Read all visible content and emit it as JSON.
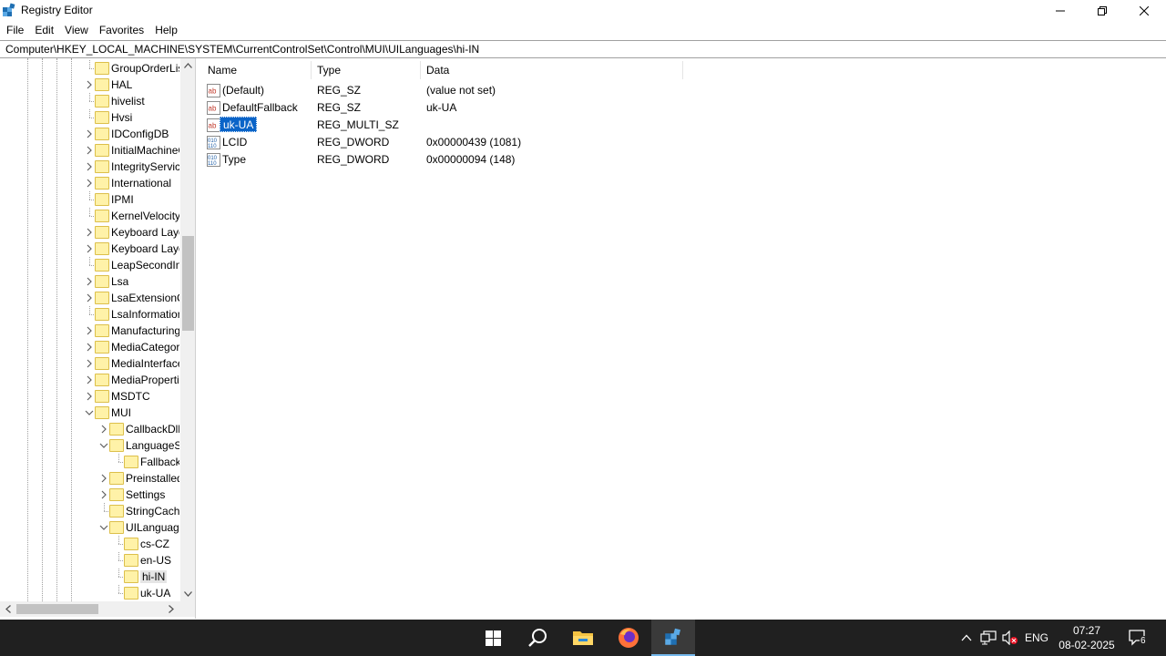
{
  "window": {
    "title": "Registry Editor",
    "min_icon": "minimize-icon",
    "max_icon": "restore-icon",
    "close_icon": "close-icon"
  },
  "menu": [
    "File",
    "Edit",
    "View",
    "Favorites",
    "Help"
  ],
  "address": "Computer\\HKEY_LOCAL_MACHINE\\SYSTEM\\CurrentControlSet\\Control\\MUI\\UILanguages\\hi-IN",
  "tree": {
    "items": [
      {
        "label": "GroupOrderList",
        "expand": "none",
        "level": 0
      },
      {
        "label": "HAL",
        "expand": "collapsed",
        "level": 0
      },
      {
        "label": "hivelist",
        "expand": "none",
        "level": 0
      },
      {
        "label": "Hvsi",
        "expand": "none",
        "level": 0
      },
      {
        "label": "IDConfigDB",
        "expand": "collapsed",
        "level": 0
      },
      {
        "label": "InitialMachineConfig",
        "expand": "collapsed",
        "level": 0
      },
      {
        "label": "IntegrityServices",
        "expand": "collapsed",
        "level": 0
      },
      {
        "label": "International",
        "expand": "collapsed",
        "level": 0
      },
      {
        "label": "IPMI",
        "expand": "none",
        "level": 0
      },
      {
        "label": "KernelVelocity",
        "expand": "none",
        "level": 0
      },
      {
        "label": "Keyboard Layout",
        "expand": "collapsed",
        "level": 0
      },
      {
        "label": "Keyboard Layouts",
        "expand": "collapsed",
        "level": 0
      },
      {
        "label": "LeapSecondInformation",
        "expand": "none",
        "level": 0
      },
      {
        "label": "Lsa",
        "expand": "collapsed",
        "level": 0
      },
      {
        "label": "LsaExtensionConfig",
        "expand": "collapsed",
        "level": 0
      },
      {
        "label": "LsaInformation",
        "expand": "none",
        "level": 0
      },
      {
        "label": "ManufacturingMode",
        "expand": "collapsed",
        "level": 0
      },
      {
        "label": "MediaCategories",
        "expand": "collapsed",
        "level": 0
      },
      {
        "label": "MediaInterfaces",
        "expand": "collapsed",
        "level": 0
      },
      {
        "label": "MediaProperties",
        "expand": "collapsed",
        "level": 0
      },
      {
        "label": "MSDTC",
        "expand": "collapsed",
        "level": 0
      },
      {
        "label": "MUI",
        "expand": "expanded",
        "level": 0
      },
      {
        "label": "CallbackDlls",
        "expand": "collapsed",
        "level": 1
      },
      {
        "label": "LanguageSetup",
        "expand": "expanded",
        "level": 1
      },
      {
        "label": "Fallback",
        "expand": "none",
        "level": 2
      },
      {
        "label": "PreinstalledLanguages",
        "expand": "collapsed",
        "level": 1
      },
      {
        "label": "Settings",
        "expand": "collapsed",
        "level": 1
      },
      {
        "label": "StringCacheSettings",
        "expand": "none",
        "level": 1
      },
      {
        "label": "UILanguages",
        "expand": "expanded",
        "level": 1
      },
      {
        "label": "cs-CZ",
        "expand": "none",
        "level": 2
      },
      {
        "label": "en-US",
        "expand": "none",
        "level": 2
      },
      {
        "label": "hi-IN",
        "expand": "none",
        "level": 2,
        "selected": true
      },
      {
        "label": "uk-UA",
        "expand": "none",
        "level": 2
      }
    ]
  },
  "columns": {
    "name": "Name",
    "type": "Type",
    "data": "Data"
  },
  "values": [
    {
      "icon": "string-value-icon",
      "name": "(Default)",
      "type": "REG_SZ",
      "data": "(value not set)"
    },
    {
      "icon": "string-value-icon",
      "name": "DefaultFallback",
      "type": "REG_SZ",
      "data": "uk-UA"
    },
    {
      "icon": "string-value-icon",
      "name": "uk-UA",
      "type": "REG_MULTI_SZ",
      "data": "",
      "selected": true
    },
    {
      "icon": "binary-value-icon",
      "name": "LCID",
      "type": "REG_DWORD",
      "data": "0x00000439 (1081)"
    },
    {
      "icon": "binary-value-icon",
      "name": "Type",
      "type": "REG_DWORD",
      "data": "0x00000094 (148)"
    }
  ],
  "taskbar": {
    "apps": [
      "start-icon",
      "search-icon",
      "file-explorer-icon",
      "firefox-icon",
      "registry-editor-icon"
    ],
    "language": "ENG",
    "time": "07:27",
    "date": "08-02-2025",
    "notifications": "6"
  },
  "colors": {
    "selection": "#0a64c8",
    "taskbar": "#202020",
    "folder": "#fff2a8"
  }
}
